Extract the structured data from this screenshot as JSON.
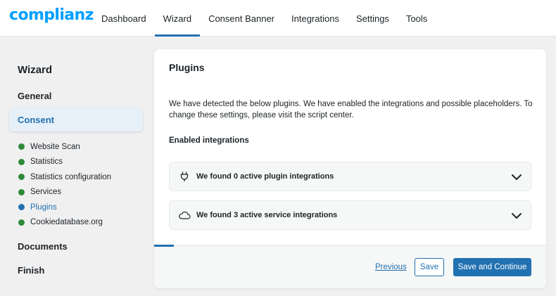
{
  "app": {
    "logo_text": "complianz",
    "brand_color": "#009fff",
    "accent_color": "#2271b1",
    "success_color": "#2e8a37"
  },
  "nav": {
    "items": [
      {
        "label": "Dashboard"
      },
      {
        "label": "Wizard"
      },
      {
        "label": "Consent Banner"
      },
      {
        "label": "Integrations"
      },
      {
        "label": "Settings"
      },
      {
        "label": "Tools"
      }
    ],
    "active": "Wizard"
  },
  "sidebar": {
    "title": "Wizard",
    "sections": {
      "general": "General",
      "consent": "Consent",
      "documents": "Documents",
      "finish": "Finish"
    },
    "steps": [
      {
        "label": "Website Scan",
        "status": "complete"
      },
      {
        "label": "Statistics",
        "status": "complete"
      },
      {
        "label": "Statistics configuration",
        "status": "complete"
      },
      {
        "label": "Services",
        "status": "complete"
      },
      {
        "label": "Plugins",
        "status": "active"
      },
      {
        "label": "Cookiedatabase.org",
        "status": "complete"
      }
    ]
  },
  "main": {
    "title": "Plugins",
    "description": "We have detected the below plugins. We have enabled the integrations and possible placeholders. To change these settings, please visit the script center.",
    "subtitle": "Enabled integrations",
    "accordions": [
      {
        "label": "We found 0 active plugin integrations",
        "icon": "plug-icon"
      },
      {
        "label": "We found 3 active service integrations",
        "icon": "cloud-icon"
      }
    ],
    "progress_fraction": 0.05
  },
  "footer": {
    "previous_label": "Previous",
    "save_label": "Save",
    "continue_label": "Save and Continue"
  }
}
